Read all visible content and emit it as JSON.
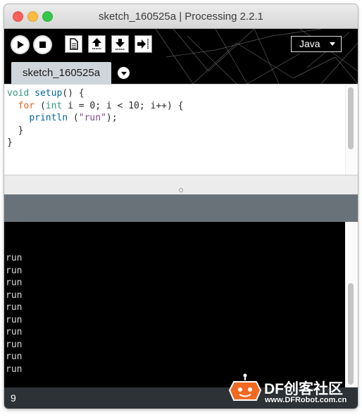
{
  "window": {
    "title": "sketch_160525a | Processing 2.2.1"
  },
  "toolbar": {
    "buttons": [
      {
        "name": "run-button",
        "icon": "play-icon"
      },
      {
        "name": "stop-button",
        "icon": "stop-icon"
      },
      {
        "name": "new-button",
        "icon": "new-document-icon"
      },
      {
        "name": "open-button",
        "icon": "upload-arrow-icon"
      },
      {
        "name": "save-button",
        "icon": "download-arrow-icon"
      },
      {
        "name": "export-button",
        "icon": "export-arrow-icon"
      }
    ],
    "mode_label": "Java"
  },
  "tabs": [
    {
      "label": "sketch_160525a",
      "active": true
    }
  ],
  "editor": {
    "code_lines": [
      "void setup() {",
      "  for (int i = 0; i < 10; i++) {",
      "    println (\"run\");",
      "  }",
      "}"
    ]
  },
  "console": {
    "lines": [
      "run",
      "run",
      "run",
      "run",
      "run",
      "run",
      "run",
      "run",
      "run",
      "run"
    ]
  },
  "status": {
    "line_number": "9"
  },
  "watermark": {
    "brand": "DF创客社区",
    "url": "www.DFRobot.com.cn"
  },
  "colors": {
    "header_bg": "#000000",
    "tab_bg": "#cfd6db",
    "message_area": "#6a7279",
    "console_bg": "#000000",
    "status_bar": "#2c3236",
    "keyword": "#33997e",
    "control_keyword": "#e2661a",
    "function": "#006699",
    "string": "#7d4793"
  }
}
